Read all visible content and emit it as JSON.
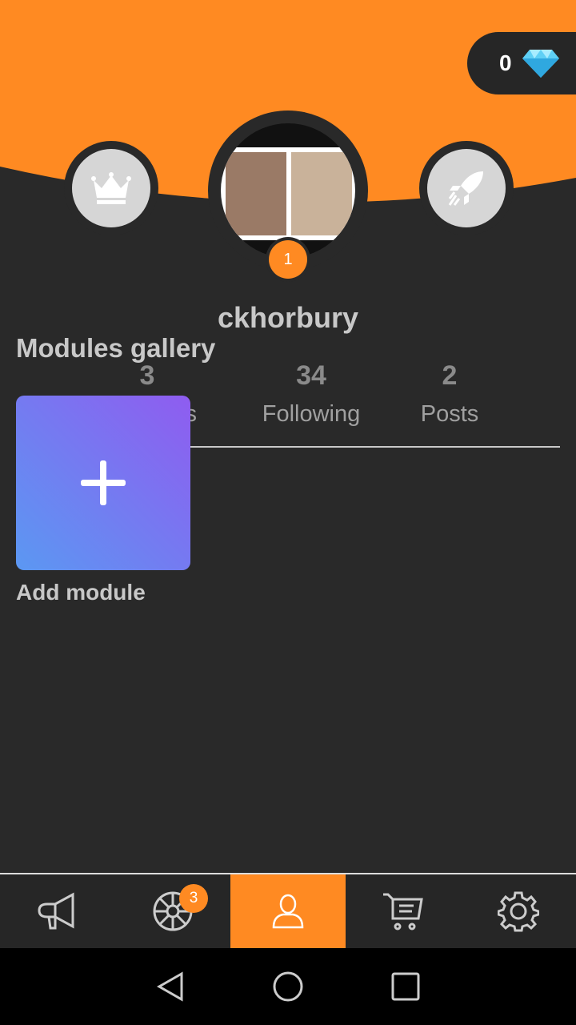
{
  "colors": {
    "accent": "#ff8a22",
    "background": "#292929"
  },
  "header": {
    "gems": "0",
    "gem_icon": "diamond-icon",
    "left_icon": "crown-icon",
    "right_icon": "rocket-icon",
    "notification_count": "1"
  },
  "profile": {
    "username": "ckhorbury",
    "stats": [
      {
        "value": "3",
        "label": "Followers"
      },
      {
        "value": "34",
        "label": "Following"
      },
      {
        "value": "2",
        "label": "Posts"
      }
    ]
  },
  "modules": {
    "title": "Modules gallery",
    "add_label": "Add module"
  },
  "nav": {
    "items": [
      {
        "icon": "megaphone-icon"
      },
      {
        "icon": "wheel-icon",
        "badge": "3"
      },
      {
        "icon": "user-icon",
        "active": true
      },
      {
        "icon": "cart-icon"
      },
      {
        "icon": "gear-icon"
      }
    ]
  }
}
